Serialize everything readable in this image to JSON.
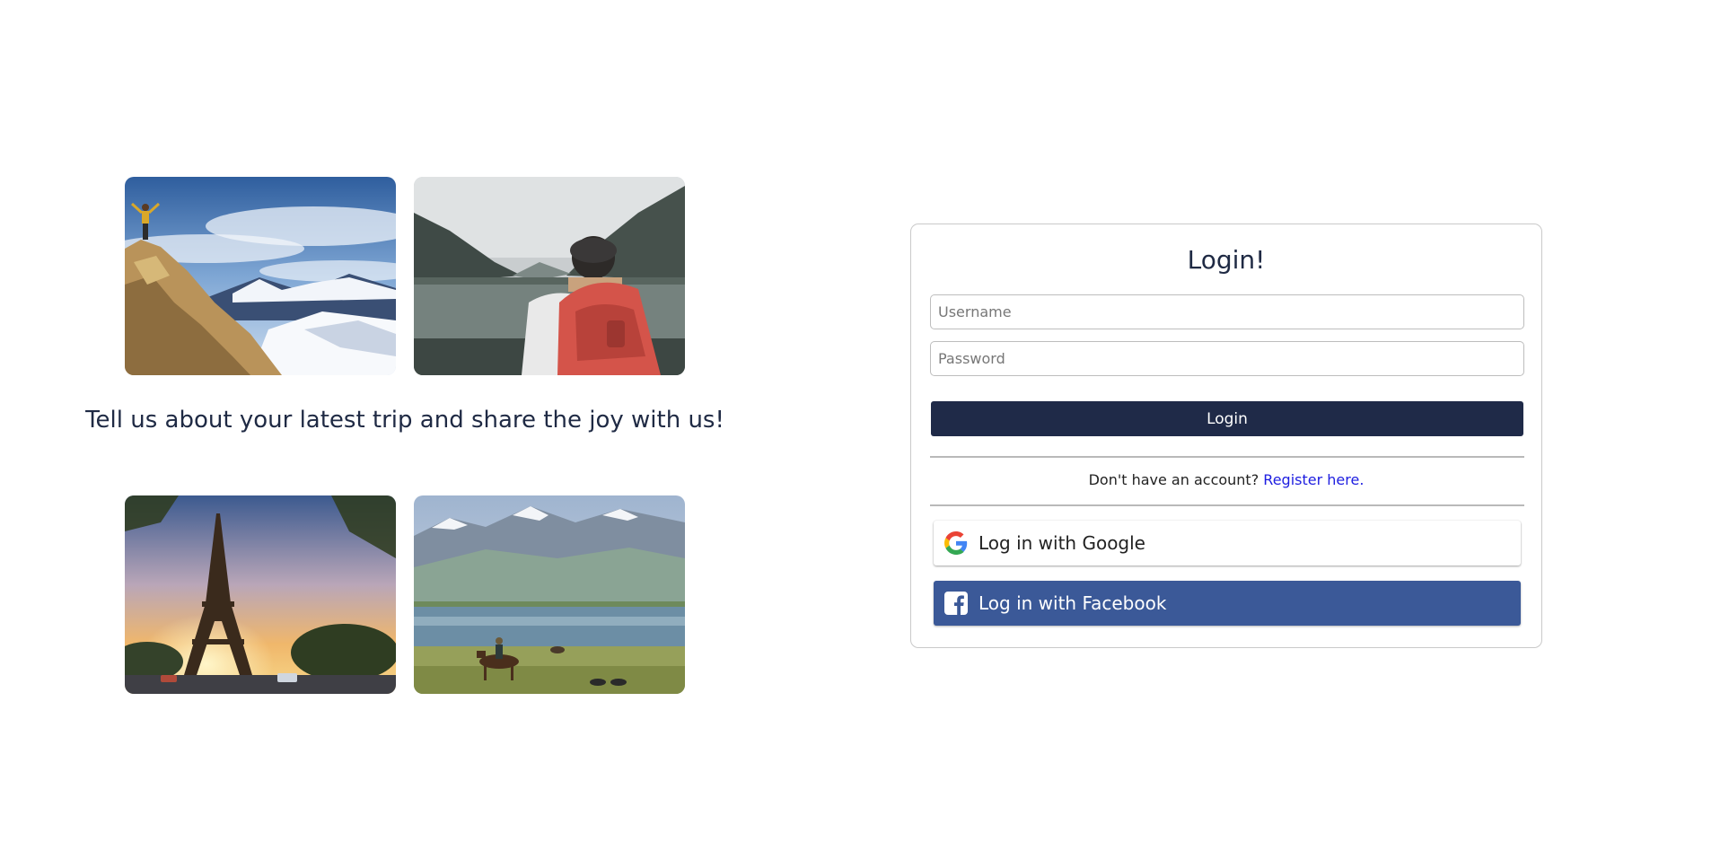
{
  "gallery": {
    "tagline": "Tell us about your latest trip and share the joy with us!",
    "photos": [
      {
        "name": "mountain-summit-photo"
      },
      {
        "name": "lake-hiker-backpack-photo"
      },
      {
        "name": "eiffel-tower-sunset-photo"
      },
      {
        "name": "steppe-lake-horse-rider-photo"
      }
    ]
  },
  "login": {
    "title": "Login!",
    "username_placeholder": "Username",
    "password_placeholder": "Password",
    "submit_label": "Login",
    "register_prompt": "Don't have an account?",
    "register_link": "Register here.",
    "google_label": "Log in with Google",
    "facebook_label": "Log in with Facebook",
    "google_icon": "google-icon",
    "facebook_icon": "facebook-icon"
  },
  "colors": {
    "primary_button": "#1f2a48",
    "facebook_blue": "#3b5998",
    "link_blue": "#1d1de0",
    "text_dark": "#1f2a44"
  }
}
